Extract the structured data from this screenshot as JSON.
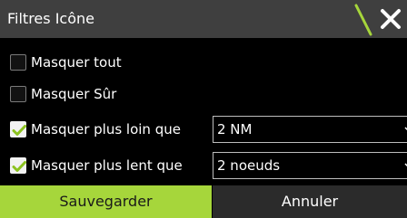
{
  "dialog": {
    "title": "Filtres Icône",
    "close_icon": "close-icon",
    "accent_color": "#a6d63b"
  },
  "options": [
    {
      "label": "Masquer tout",
      "checked": false
    },
    {
      "label": "Masquer Sûr",
      "checked": false
    },
    {
      "label": "Masquer plus loin que",
      "checked": true,
      "value": "2 NM"
    },
    {
      "label": "Masquer plus lent que",
      "checked": true,
      "value": "2 noeuds"
    }
  ],
  "buttons": {
    "save_label": "Sauvegarder",
    "cancel_label": "Annuler"
  }
}
